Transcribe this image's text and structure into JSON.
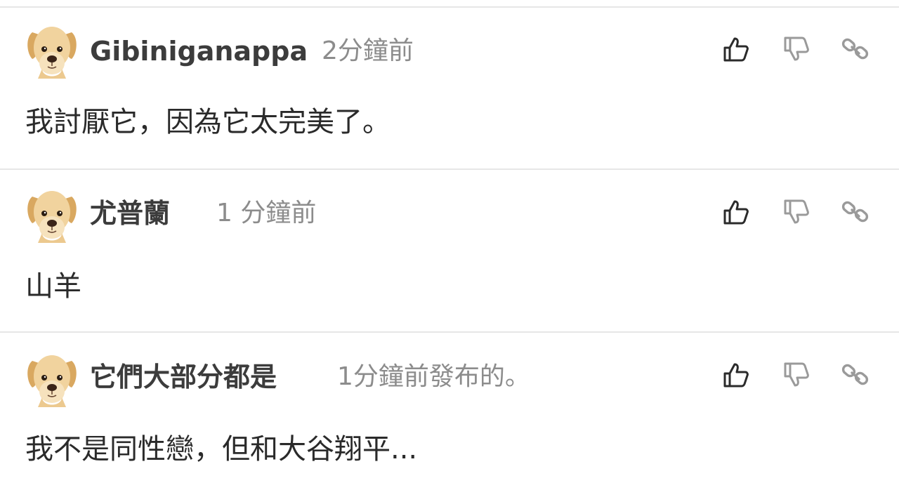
{
  "comments": [
    {
      "username": "Gibiniganappa",
      "timestamp": "2分鐘前",
      "body": "我討厭它，因為它太完美了。"
    },
    {
      "username": "尤普蘭",
      "timestamp": "1 分鐘前",
      "body": "山羊"
    },
    {
      "username": "它們大部分都是",
      "timestamp": "1分鐘前發布的。",
      "body": "我不是同性戀，但和大谷翔平..."
    }
  ],
  "icons": {
    "avatar": "puppy-avatar-icon",
    "upvote": "thumbs-up-icon",
    "downvote": "thumbs-down-icon",
    "share": "link-icon"
  },
  "colors": {
    "username": "#3c3c3c",
    "timestamp": "#8c8c8c",
    "body": "#2a2a2a",
    "icon_active": "#2b2b2b",
    "icon_muted": "#9a9a9a",
    "divider": "#e6e6e6",
    "avatar_fur": "#ecc98f"
  }
}
